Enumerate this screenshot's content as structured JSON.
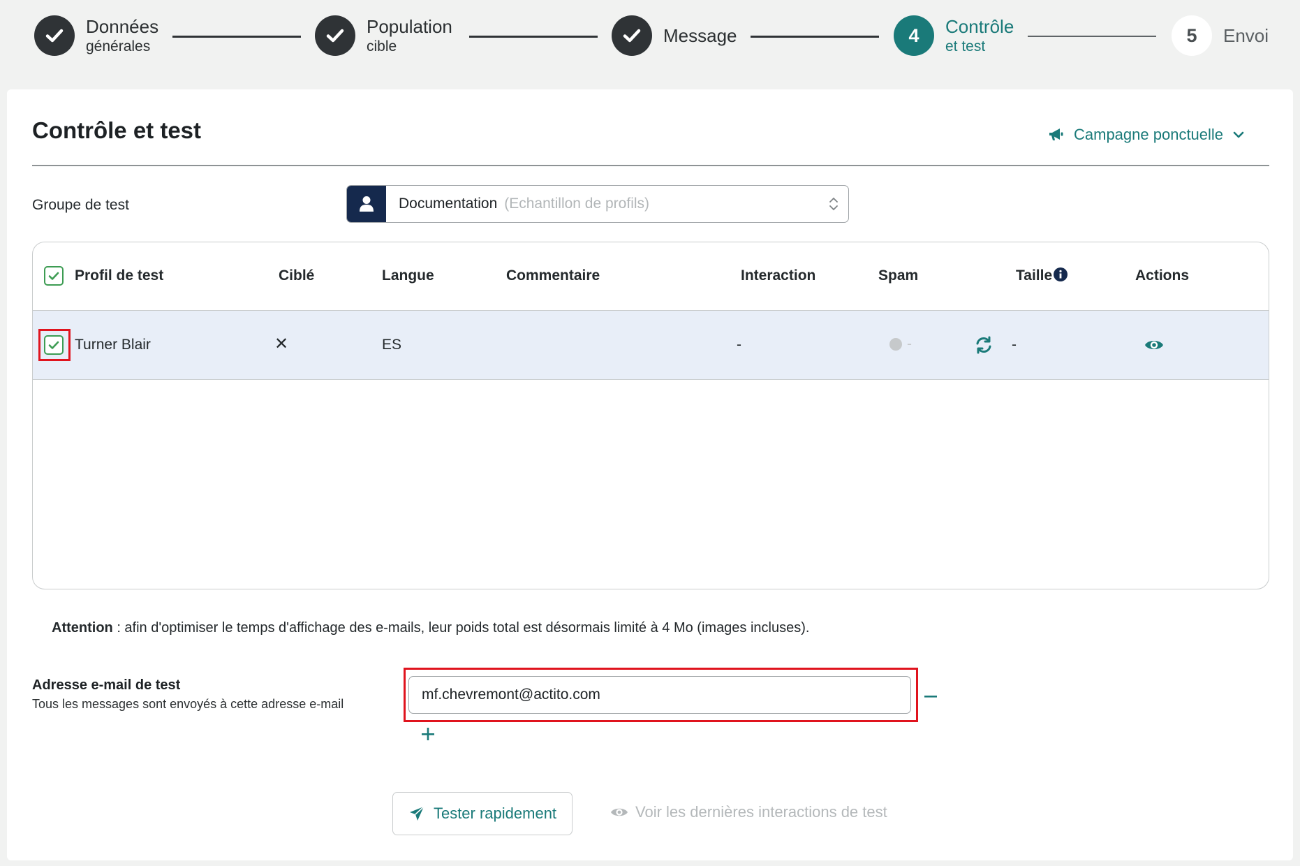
{
  "stepper": {
    "steps": [
      {
        "title": "Données",
        "subtitle": "générales",
        "state": "done"
      },
      {
        "title": "Population",
        "subtitle": "cible",
        "state": "done"
      },
      {
        "title": "Message",
        "subtitle": "",
        "state": "done"
      },
      {
        "number": "4",
        "title": "Contrôle",
        "subtitle": "et test",
        "state": "active"
      },
      {
        "number": "5",
        "title": "Envoi",
        "subtitle": "",
        "state": "todo"
      }
    ]
  },
  "page": {
    "title": "Contrôle et test",
    "campaign_type": "Campagne ponctuelle"
  },
  "test_group": {
    "label": "Groupe de test",
    "value": "Documentation",
    "hint": "(Echantillon de profils)"
  },
  "table": {
    "columns": {
      "profile": "Profil de test",
      "targeted": "Ciblé",
      "language": "Langue",
      "comment": "Commentaire",
      "interaction": "Interaction",
      "spam": "Spam",
      "size": "Taille",
      "actions": "Actions"
    },
    "rows": [
      {
        "name": "Turner Blair",
        "targeted": "✕",
        "language": "ES",
        "comment": "",
        "interaction": "-",
        "spam": "-",
        "size": "-",
        "checked": true
      }
    ]
  },
  "notice": {
    "bold": "Attention",
    "text": " : afin d'optimiser le temps d'affichage des e-mails, leur poids total est désormais limité à 4 Mo (images incluses)."
  },
  "test_email": {
    "label": "Adresse e-mail de test",
    "description": "Tous les messages sont envoyés à cette adresse e-mail",
    "value": "mf.chevremont@actito.com"
  },
  "actions": {
    "quick_test": "Tester rapidement",
    "view_interactions": "Voir les dernières interactions de test"
  },
  "colors": {
    "accent": "#1a7a79",
    "done_step": "#2f3336",
    "highlight": "#e0141e",
    "row_selected": "#e8eef8",
    "group_icon_bg": "#15294d",
    "checkbox": "#3d9c53"
  },
  "icons": [
    "check-icon",
    "megaphone-icon",
    "chevron-down-icon",
    "user-icon",
    "updown-icon",
    "info-icon",
    "close-icon",
    "refresh-icon",
    "eye-icon",
    "minus-icon",
    "plus-icon",
    "send-icon"
  ]
}
